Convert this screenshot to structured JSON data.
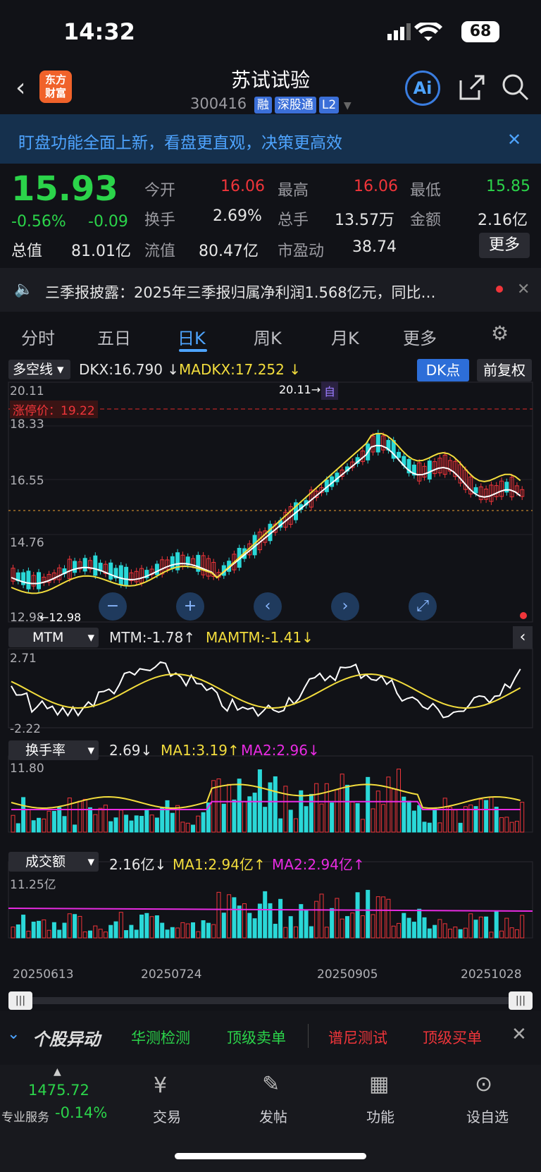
{
  "status": {
    "time": "14:32",
    "battery": "68"
  },
  "header": {
    "title": "苏试试验",
    "code": "300416",
    "tags": [
      "融",
      "深股通",
      "L2"
    ],
    "logo": [
      "东方",
      "财富"
    ]
  },
  "banner": {
    "text": "盯盘功能全面上新，看盘更直观，决策更高效"
  },
  "quote": {
    "price": "15.93",
    "change_pct": "-0.56%",
    "change": "-0.09",
    "open_label": "今开",
    "open": "16.06",
    "high_label": "最高",
    "high": "16.06",
    "low_label": "最低",
    "low": "15.85",
    "turnover_label": "换手",
    "turnover": "2.69%",
    "volume_label": "总手",
    "volume": "13.57万",
    "amount_label": "金额",
    "amount": "2.16亿",
    "mcap_label": "总值",
    "mcap": "81.01亿",
    "float_label": "流值",
    "float": "80.47亿",
    "pe_label": "市盈动",
    "pe": "38.74",
    "more": "更多"
  },
  "news": {
    "text": "三季报披露：2025年三季报归属净利润1.568亿元，同比…"
  },
  "tabs": [
    "分时",
    "五日",
    "日K",
    "周K",
    "月K",
    "更多"
  ],
  "main_indicator": {
    "name": "多空线",
    "dkx": "DKX:16.790",
    "madkx": "MADKX:17.252",
    "dk_button": "DK点",
    "adjust_button": "前复权"
  },
  "main_axis": {
    "top": "20.11",
    "l2": "18.33",
    "l3": "16.55",
    "l4": "14.76",
    "bottom": "12.98",
    "limit": "涨停价：19.22",
    "high_mark": "20.11→",
    "low_mark": "←12.98",
    "self_tag": "自"
  },
  "mtm": {
    "name": "MTM",
    "val": "MTM:-1.78",
    "ma": "MAMTM:-1.41",
    "top": "2.71",
    "bottom": "-2.22"
  },
  "turnover": {
    "name": "换手率",
    "val": "2.69",
    "ma1": "MA1:3.19",
    "ma2": "MA2:2.96",
    "top": "11.80"
  },
  "amount": {
    "name": "成交额",
    "val": "2.16亿",
    "ma1": "MA1:2.94亿",
    "ma2": "MA2:2.94亿",
    "top": "11.25亿"
  },
  "dates": [
    "20250613",
    "20250724",
    "20250905",
    "20251028"
  ],
  "ticker": {
    "title": "个股异动",
    "items": [
      "华测检测",
      "顶级卖单",
      "谱尼测试",
      "顶级买单"
    ]
  },
  "bottom_nav": {
    "index_value": "1475.72",
    "index_label": "专业服务",
    "index_change": "-0.14%",
    "items": [
      "交易",
      "发帖",
      "功能",
      "设自选"
    ]
  },
  "colors": {
    "up": "#f0353a",
    "down": "#2bd44a",
    "accent": "#4ea4ff"
  }
}
